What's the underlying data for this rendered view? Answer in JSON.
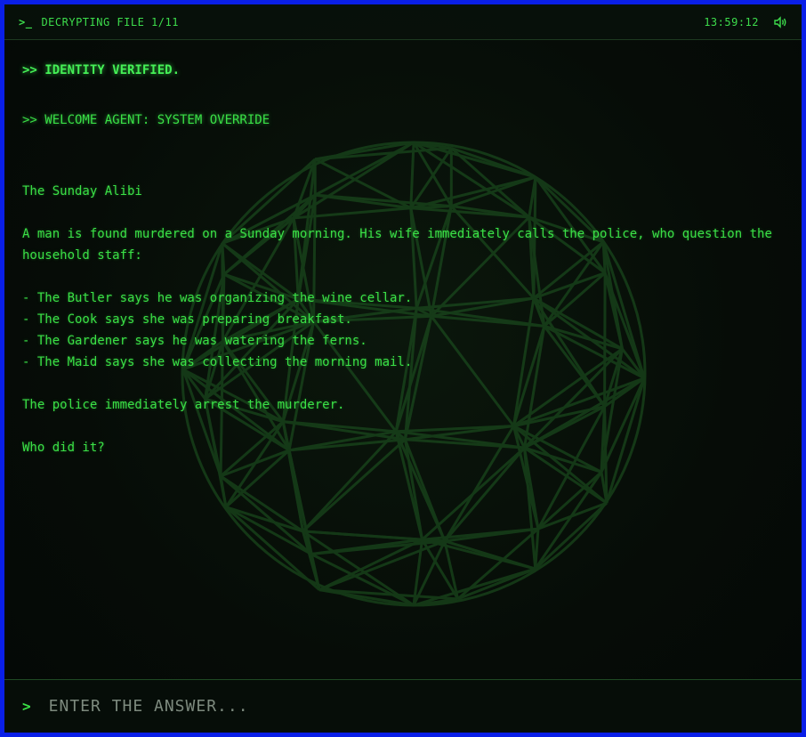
{
  "header": {
    "prompt_glyph": ">_",
    "title": "DECRYPTING FILE 1/11",
    "clock": "13:59:12",
    "sound_icon": "speaker-icon"
  },
  "log": {
    "verified": ">> IDENTITY VERIFIED.",
    "welcome": ">> WELCOME AGENT: SYSTEM OVERRIDE"
  },
  "puzzle": {
    "title": "The Sunday Alibi",
    "intro": "A man is found murdered on a Sunday morning. His wife immediately calls the police, who question the household staff:",
    "statements": [
      "- The Butler says he was organizing the wine cellar.",
      "- The Cook says she was preparing breakfast.",
      "- The Gardener says he was watering the ferns.",
      "- The Maid says she was collecting the morning mail."
    ],
    "outcome": "The police immediately arrest the murderer.",
    "question": "Who did it?"
  },
  "answer": {
    "prompt": ">",
    "placeholder": "ENTER THE ANSWER..."
  },
  "colors": {
    "frame_border": "#0a1fe8",
    "terminal_green": "#3ae046",
    "background": "#050a06"
  }
}
